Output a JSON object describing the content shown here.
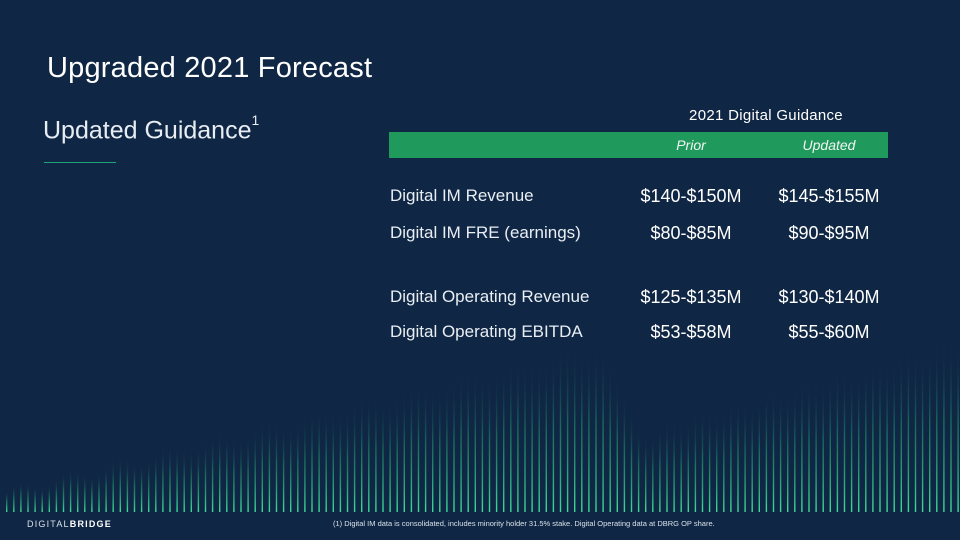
{
  "title": "Upgraded 2021 Forecast",
  "subtitle": "Updated Guidance",
  "subtitle_sup": "1",
  "table": {
    "title": "2021 Digital Guidance",
    "columns": [
      "Prior",
      "Updated"
    ],
    "rows": [
      {
        "label": "Digital IM Revenue",
        "prior": "$140-$150M",
        "updated": "$145-$155M"
      },
      {
        "label": "Digital IM FRE (earnings)",
        "prior": "$80-$85M",
        "updated": "$90-$95M"
      },
      {
        "label": "Digital Operating Revenue",
        "prior": "$125-$135M",
        "updated": "$130-$140M"
      },
      {
        "label": "Digital Operating EBITDA",
        "prior": "$53-$58M",
        "updated": "$55-$60M"
      }
    ]
  },
  "footer": {
    "logo_part1": "DIGITAL",
    "logo_part2": "BRIDGE",
    "footnote": "(1) Digital IM data is consolidated, includes minority holder 31.5% stake. Digital Operating data at DBRG OP share."
  },
  "colors": {
    "background": "#0f2744",
    "accent_green": "#1f9a5c",
    "rule": "#1fa37a"
  }
}
